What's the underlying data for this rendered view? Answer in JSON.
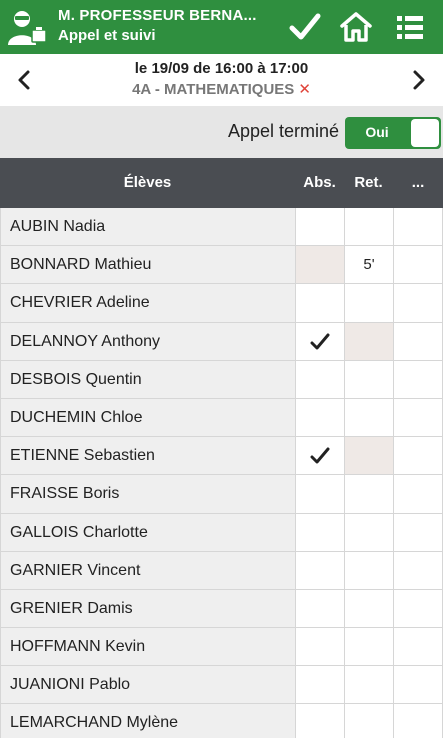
{
  "header": {
    "teacher": "M. PROFESSEUR BERNA...",
    "subtitle": "Appel et suivi",
    "icons": [
      "teacher-avatar-icon",
      "check-icon",
      "home-icon",
      "list-icon"
    ]
  },
  "session": {
    "time": "le 19/09 de 16:00 à 17:00",
    "course": "4A - MATHEMATIQUES",
    "course_mark": "✕"
  },
  "appel": {
    "label": "Appel terminé",
    "toggle": "Oui"
  },
  "table": {
    "headers": [
      "Élèves",
      "Abs.",
      "Ret.",
      "..."
    ],
    "rows": [
      {
        "name": "AUBIN Nadia",
        "abs": "",
        "ret": ""
      },
      {
        "name": "BONNARD Mathieu",
        "abs": "",
        "ret": "5'"
      },
      {
        "name": "CHEVRIER Adeline",
        "abs": "",
        "ret": ""
      },
      {
        "name": "DELANNOY Anthony",
        "abs": "✔",
        "ret": ""
      },
      {
        "name": "DESBOIS Quentin",
        "abs": "",
        "ret": ""
      },
      {
        "name": "DUCHEMIN Chloe",
        "abs": "",
        "ret": ""
      },
      {
        "name": "ETIENNE Sebastien",
        "abs": "✔",
        "ret": ""
      },
      {
        "name": "FRAISSE Boris",
        "abs": "",
        "ret": ""
      },
      {
        "name": "GALLOIS Charlotte",
        "abs": "",
        "ret": ""
      },
      {
        "name": "GARNIER Vincent",
        "abs": "",
        "ret": ""
      },
      {
        "name": "GRENIER Damis",
        "abs": "",
        "ret": ""
      },
      {
        "name": "HOFFMANN Kevin",
        "abs": "",
        "ret": ""
      },
      {
        "name": "JUANIONI Pablo",
        "abs": "",
        "ret": ""
      },
      {
        "name": "LEMARCHAND Mylène",
        "abs": "",
        "ret": ""
      }
    ]
  },
  "colors": {
    "brand_green": "#2f8f3f",
    "header_dark": "#4a4d52",
    "cancel_red": "#e0443a"
  }
}
